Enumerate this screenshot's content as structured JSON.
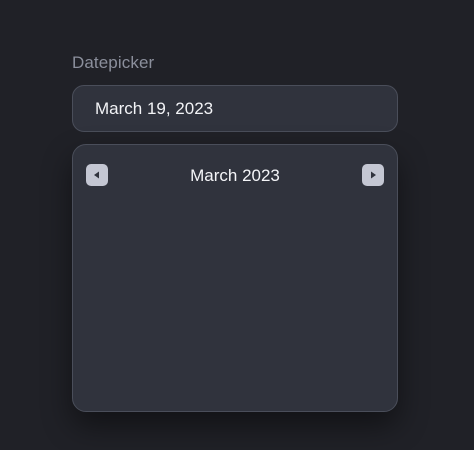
{
  "datepicker": {
    "label": "Datepicker",
    "value": "March 19, 2023",
    "calendar": {
      "month_title": "March 2023",
      "prev_icon": "triangle-left-icon",
      "next_icon": "triangle-right-icon"
    }
  },
  "colors": {
    "background": "#202127",
    "panel": "#30333d",
    "border": "#4a4e5a",
    "label": "#8b8f9c",
    "nav_button": "#c4c7d3",
    "nav_icon": "#30333d"
  }
}
